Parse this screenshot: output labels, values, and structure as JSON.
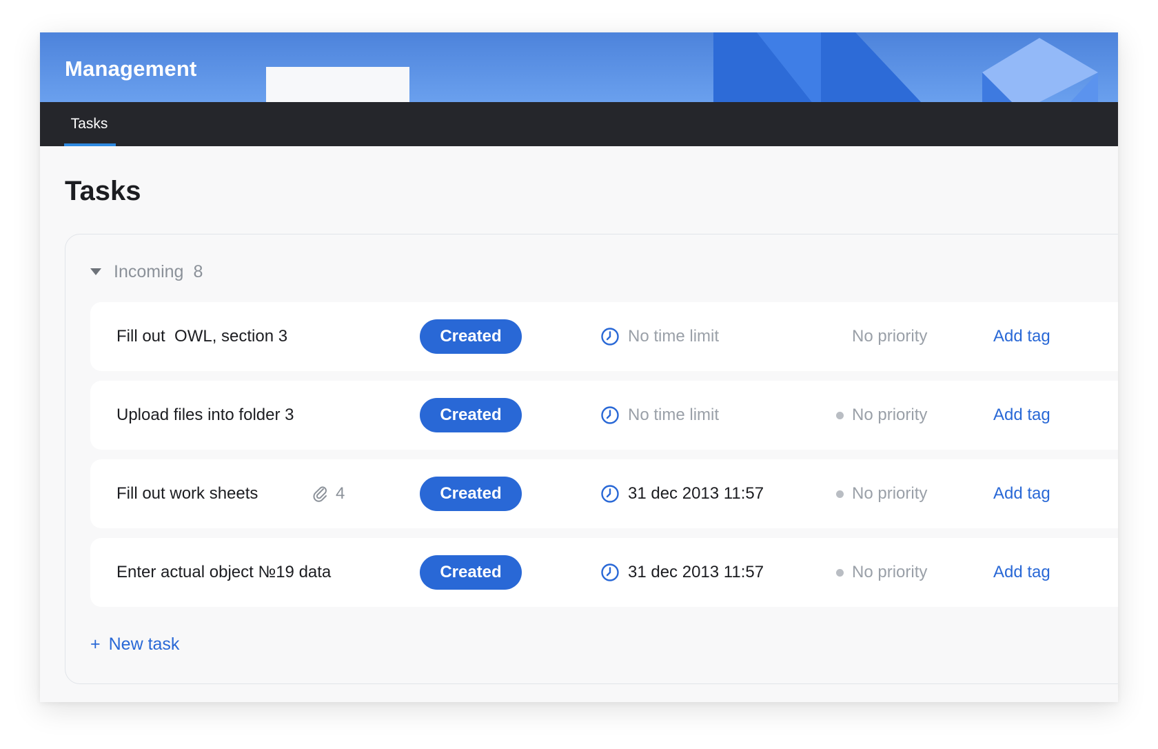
{
  "app": {
    "title": "Management"
  },
  "nav": {
    "tabs": [
      {
        "label": "Tasks",
        "active": true
      }
    ]
  },
  "page": {
    "title": "Tasks"
  },
  "group": {
    "name": "Incoming",
    "count": "8"
  },
  "tasks": [
    {
      "title": "Fill out  OWL, section 3",
      "attachments": "",
      "status": "Created",
      "deadline": "No time limit",
      "deadline_set": false,
      "priority": "No priority",
      "priority_dot": false,
      "tag_action": "Add tag"
    },
    {
      "title": "Upload files into folder 3",
      "attachments": "",
      "status": "Created",
      "deadline": "No time limit",
      "deadline_set": false,
      "priority": "No priority",
      "priority_dot": true,
      "tag_action": "Add tag"
    },
    {
      "title": "Fill out work sheets",
      "attachments": "4",
      "status": "Created",
      "deadline": "31 dec 2013 11:57",
      "deadline_set": true,
      "priority": "No priority",
      "priority_dot": true,
      "tag_action": "Add tag"
    },
    {
      "title": "Enter actual object №19 data",
      "attachments": "",
      "status": "Created",
      "deadline": "31 dec 2013 11:57",
      "deadline_set": true,
      "priority": "No priority",
      "priority_dot": true,
      "tag_action": "Add tag"
    }
  ],
  "actions": {
    "new_task_icon": "+",
    "new_task": "New task"
  },
  "icons": {
    "clock": "clock-icon",
    "attachment": "paperclip-icon",
    "collapse": "caret-down-icon",
    "priority": "dot-icon"
  },
  "colors": {
    "accent": "#2968d6",
    "header_start": "#4d83db",
    "header_end": "#6aa0ee",
    "navbar": "#25262b",
    "tab_underline": "#2e89e0"
  }
}
